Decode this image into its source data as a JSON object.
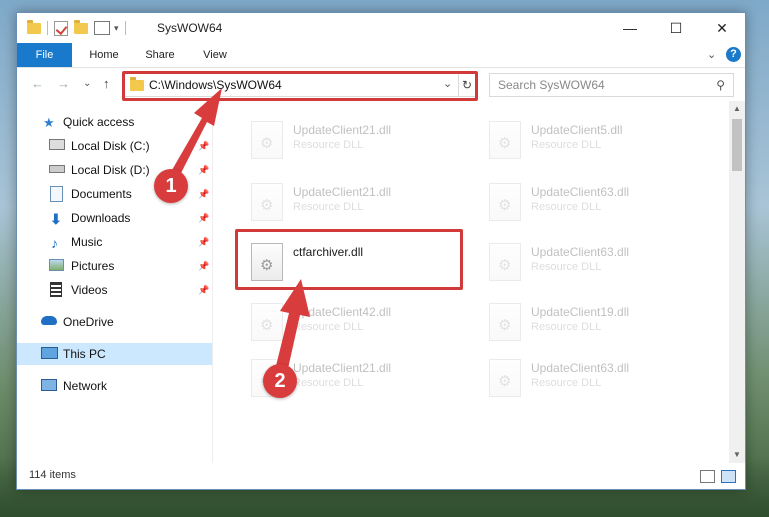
{
  "window": {
    "title": "SysWOW64",
    "controls": {
      "minimize": "—",
      "maximize": "☐",
      "close": "✕"
    }
  },
  "ribbon": {
    "tabs": [
      "File",
      "Home",
      "Share",
      "View"
    ],
    "help": "?"
  },
  "navigation": {
    "back": "←",
    "forward": "→",
    "recent": "⌄",
    "up": "↑"
  },
  "address": {
    "path": "C:\\Windows\\SysWOW64",
    "dropdown": "⌄",
    "refresh": "↻"
  },
  "search": {
    "placeholder": "Search SysWOW64",
    "icon": "magnifier-icon"
  },
  "sidebar": {
    "items": [
      {
        "label": "Quick access",
        "icon": "star-icon",
        "pinned": false
      },
      {
        "label": "Local Disk (C:)",
        "icon": "drive-icon",
        "pinned": true
      },
      {
        "label": "Local Disk (D:)",
        "icon": "drive-icon",
        "pinned": true
      },
      {
        "label": "Documents",
        "icon": "documents-icon",
        "pinned": true
      },
      {
        "label": "Downloads",
        "icon": "download-icon",
        "pinned": true
      },
      {
        "label": "Music",
        "icon": "music-icon",
        "pinned": true
      },
      {
        "label": "Pictures",
        "icon": "pictures-icon",
        "pinned": true
      },
      {
        "label": "Videos",
        "icon": "videos-icon",
        "pinned": true
      },
      {
        "label": "OneDrive",
        "icon": "cloud-icon",
        "pinned": false
      },
      {
        "label": "This PC",
        "icon": "computer-icon",
        "pinned": false,
        "selected": true
      },
      {
        "label": "Network",
        "icon": "network-icon",
        "pinned": false
      }
    ],
    "pin_glyph": "📌"
  },
  "files": [
    {
      "name": "UpdateClient21.dll",
      "desc": "Resource DLL",
      "faded": true
    },
    {
      "name": "UpdateClient5.dll",
      "desc": "Resource DLL",
      "faded": true
    },
    {
      "name": "UpdateClient21.dll",
      "desc": "Resource DLL",
      "faded": true
    },
    {
      "name": "UpdateClient63.dll",
      "desc": "Resource DLL",
      "faded": true
    },
    {
      "name": "ctfarchiver.dll",
      "desc": "",
      "faded": false,
      "highlighted": true
    },
    {
      "name": "UpdateClient63.dll",
      "desc": "Resource DLL",
      "faded": true
    },
    {
      "name": "UpdateClient42.dll",
      "desc": "Resource DLL",
      "faded": true
    },
    {
      "name": "UpdateClient19.dll",
      "desc": "Resource DLL",
      "faded": true
    },
    {
      "name": "UpdateClient21.dll",
      "desc": "Resource DLL",
      "faded": true
    },
    {
      "name": "UpdateClient63.dll",
      "desc": "Resource DLL",
      "faded": true
    }
  ],
  "status": {
    "item_count": "114 items"
  },
  "annotations": {
    "step1": "1",
    "step2": "2",
    "color": "#d93c3c"
  }
}
